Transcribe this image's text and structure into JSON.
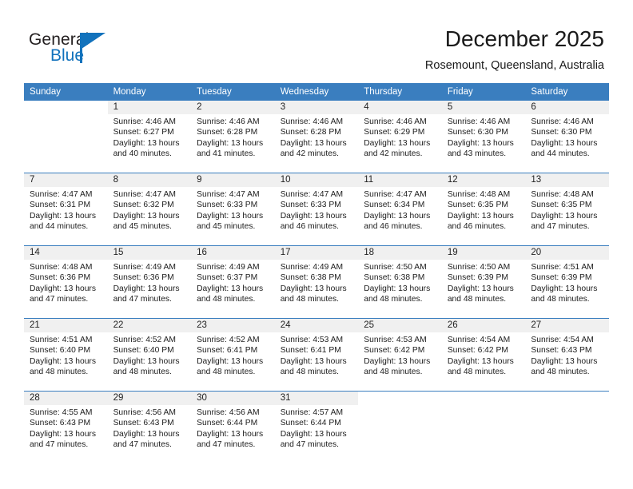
{
  "brand": {
    "name_part1": "General",
    "name_part2": "Blue",
    "triangle_color": "#1272bc",
    "text_color": "#231f20"
  },
  "header": {
    "month_year": "December 2025",
    "location": "Rosemount, Queensland, Australia"
  },
  "theme": {
    "header_bar_color": "#3a7ebf",
    "header_text_color": "#ffffff",
    "daynum_band_color": "#f0f0f0",
    "week_separator_color": "#3a7ebf",
    "page_background": "#ffffff"
  },
  "weekday_headers": [
    "Sunday",
    "Monday",
    "Tuesday",
    "Wednesday",
    "Thursday",
    "Friday",
    "Saturday"
  ],
  "weeks": [
    {
      "days": [
        {
          "day": "",
          "blank": true,
          "sunrise": "",
          "sunset": "",
          "daylight_line1": "",
          "daylight_line2": ""
        },
        {
          "day": "1",
          "sunrise": "Sunrise: 4:46 AM",
          "sunset": "Sunset: 6:27 PM",
          "daylight_line1": "Daylight: 13 hours",
          "daylight_line2": "and 40 minutes."
        },
        {
          "day": "2",
          "sunrise": "Sunrise: 4:46 AM",
          "sunset": "Sunset: 6:28 PM",
          "daylight_line1": "Daylight: 13 hours",
          "daylight_line2": "and 41 minutes."
        },
        {
          "day": "3",
          "sunrise": "Sunrise: 4:46 AM",
          "sunset": "Sunset: 6:28 PM",
          "daylight_line1": "Daylight: 13 hours",
          "daylight_line2": "and 42 minutes."
        },
        {
          "day": "4",
          "sunrise": "Sunrise: 4:46 AM",
          "sunset": "Sunset: 6:29 PM",
          "daylight_line1": "Daylight: 13 hours",
          "daylight_line2": "and 42 minutes."
        },
        {
          "day": "5",
          "sunrise": "Sunrise: 4:46 AM",
          "sunset": "Sunset: 6:30 PM",
          "daylight_line1": "Daylight: 13 hours",
          "daylight_line2": "and 43 minutes."
        },
        {
          "day": "6",
          "sunrise": "Sunrise: 4:46 AM",
          "sunset": "Sunset: 6:30 PM",
          "daylight_line1": "Daylight: 13 hours",
          "daylight_line2": "and 44 minutes."
        }
      ]
    },
    {
      "days": [
        {
          "day": "7",
          "sunrise": "Sunrise: 4:47 AM",
          "sunset": "Sunset: 6:31 PM",
          "daylight_line1": "Daylight: 13 hours",
          "daylight_line2": "and 44 minutes."
        },
        {
          "day": "8",
          "sunrise": "Sunrise: 4:47 AM",
          "sunset": "Sunset: 6:32 PM",
          "daylight_line1": "Daylight: 13 hours",
          "daylight_line2": "and 45 minutes."
        },
        {
          "day": "9",
          "sunrise": "Sunrise: 4:47 AM",
          "sunset": "Sunset: 6:33 PM",
          "daylight_line1": "Daylight: 13 hours",
          "daylight_line2": "and 45 minutes."
        },
        {
          "day": "10",
          "sunrise": "Sunrise: 4:47 AM",
          "sunset": "Sunset: 6:33 PM",
          "daylight_line1": "Daylight: 13 hours",
          "daylight_line2": "and 46 minutes."
        },
        {
          "day": "11",
          "sunrise": "Sunrise: 4:47 AM",
          "sunset": "Sunset: 6:34 PM",
          "daylight_line1": "Daylight: 13 hours",
          "daylight_line2": "and 46 minutes."
        },
        {
          "day": "12",
          "sunrise": "Sunrise: 4:48 AM",
          "sunset": "Sunset: 6:35 PM",
          "daylight_line1": "Daylight: 13 hours",
          "daylight_line2": "and 46 minutes."
        },
        {
          "day": "13",
          "sunrise": "Sunrise: 4:48 AM",
          "sunset": "Sunset: 6:35 PM",
          "daylight_line1": "Daylight: 13 hours",
          "daylight_line2": "and 47 minutes."
        }
      ]
    },
    {
      "days": [
        {
          "day": "14",
          "sunrise": "Sunrise: 4:48 AM",
          "sunset": "Sunset: 6:36 PM",
          "daylight_line1": "Daylight: 13 hours",
          "daylight_line2": "and 47 minutes."
        },
        {
          "day": "15",
          "sunrise": "Sunrise: 4:49 AM",
          "sunset": "Sunset: 6:36 PM",
          "daylight_line1": "Daylight: 13 hours",
          "daylight_line2": "and 47 minutes."
        },
        {
          "day": "16",
          "sunrise": "Sunrise: 4:49 AM",
          "sunset": "Sunset: 6:37 PM",
          "daylight_line1": "Daylight: 13 hours",
          "daylight_line2": "and 48 minutes."
        },
        {
          "day": "17",
          "sunrise": "Sunrise: 4:49 AM",
          "sunset": "Sunset: 6:38 PM",
          "daylight_line1": "Daylight: 13 hours",
          "daylight_line2": "and 48 minutes."
        },
        {
          "day": "18",
          "sunrise": "Sunrise: 4:50 AM",
          "sunset": "Sunset: 6:38 PM",
          "daylight_line1": "Daylight: 13 hours",
          "daylight_line2": "and 48 minutes."
        },
        {
          "day": "19",
          "sunrise": "Sunrise: 4:50 AM",
          "sunset": "Sunset: 6:39 PM",
          "daylight_line1": "Daylight: 13 hours",
          "daylight_line2": "and 48 minutes."
        },
        {
          "day": "20",
          "sunrise": "Sunrise: 4:51 AM",
          "sunset": "Sunset: 6:39 PM",
          "daylight_line1": "Daylight: 13 hours",
          "daylight_line2": "and 48 minutes."
        }
      ]
    },
    {
      "days": [
        {
          "day": "21",
          "sunrise": "Sunrise: 4:51 AM",
          "sunset": "Sunset: 6:40 PM",
          "daylight_line1": "Daylight: 13 hours",
          "daylight_line2": "and 48 minutes."
        },
        {
          "day": "22",
          "sunrise": "Sunrise: 4:52 AM",
          "sunset": "Sunset: 6:40 PM",
          "daylight_line1": "Daylight: 13 hours",
          "daylight_line2": "and 48 minutes."
        },
        {
          "day": "23",
          "sunrise": "Sunrise: 4:52 AM",
          "sunset": "Sunset: 6:41 PM",
          "daylight_line1": "Daylight: 13 hours",
          "daylight_line2": "and 48 minutes."
        },
        {
          "day": "24",
          "sunrise": "Sunrise: 4:53 AM",
          "sunset": "Sunset: 6:41 PM",
          "daylight_line1": "Daylight: 13 hours",
          "daylight_line2": "and 48 minutes."
        },
        {
          "day": "25",
          "sunrise": "Sunrise: 4:53 AM",
          "sunset": "Sunset: 6:42 PM",
          "daylight_line1": "Daylight: 13 hours",
          "daylight_line2": "and 48 minutes."
        },
        {
          "day": "26",
          "sunrise": "Sunrise: 4:54 AM",
          "sunset": "Sunset: 6:42 PM",
          "daylight_line1": "Daylight: 13 hours",
          "daylight_line2": "and 48 minutes."
        },
        {
          "day": "27",
          "sunrise": "Sunrise: 4:54 AM",
          "sunset": "Sunset: 6:43 PM",
          "daylight_line1": "Daylight: 13 hours",
          "daylight_line2": "and 48 minutes."
        }
      ]
    },
    {
      "days": [
        {
          "day": "28",
          "sunrise": "Sunrise: 4:55 AM",
          "sunset": "Sunset: 6:43 PM",
          "daylight_line1": "Daylight: 13 hours",
          "daylight_line2": "and 47 minutes."
        },
        {
          "day": "29",
          "sunrise": "Sunrise: 4:56 AM",
          "sunset": "Sunset: 6:43 PM",
          "daylight_line1": "Daylight: 13 hours",
          "daylight_line2": "and 47 minutes."
        },
        {
          "day": "30",
          "sunrise": "Sunrise: 4:56 AM",
          "sunset": "Sunset: 6:44 PM",
          "daylight_line1": "Daylight: 13 hours",
          "daylight_line2": "and 47 minutes."
        },
        {
          "day": "31",
          "sunrise": "Sunrise: 4:57 AM",
          "sunset": "Sunset: 6:44 PM",
          "daylight_line1": "Daylight: 13 hours",
          "daylight_line2": "and 47 minutes."
        },
        {
          "day": "",
          "blank": true,
          "sunrise": "",
          "sunset": "",
          "daylight_line1": "",
          "daylight_line2": ""
        },
        {
          "day": "",
          "blank": true,
          "sunrise": "",
          "sunset": "",
          "daylight_line1": "",
          "daylight_line2": ""
        },
        {
          "day": "",
          "blank": true,
          "sunrise": "",
          "sunset": "",
          "daylight_line1": "",
          "daylight_line2": ""
        }
      ]
    }
  ]
}
